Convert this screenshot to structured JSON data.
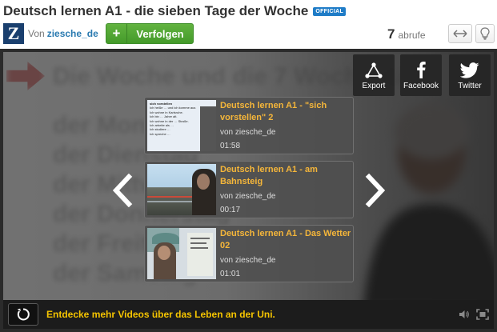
{
  "header": {
    "title": "Deutsch lernen A1 - die sieben Tage der Woche",
    "badge": "OFFICIAL",
    "logo_letter": "Z",
    "from_label": "Von",
    "username": "ziesche_de",
    "follow_label": "Verfolgen",
    "view_count": "7",
    "view_label": "abrufe"
  },
  "share": {
    "export": "Export",
    "facebook": "Facebook",
    "twitter": "Twitter"
  },
  "background_slide": {
    "heading": "Die Woche und die 7 Wochentage",
    "lines": [
      "der Montag",
      "der Dienstag",
      "der Mittwoch",
      "der Donnerstag",
      "der Freitag",
      "der Samstag"
    ]
  },
  "related_videos": [
    {
      "title": "Deutsch lernen A1 -  \"sich vorstellen\" 2",
      "by": "von ziesche_de",
      "duration": "01:58",
      "thumb_lines": [
        "sich vorstellen",
        "Ich heiße … und ich komme aus",
        "Ich wohne in Karlsruhe.",
        "Ich bin … Jahre alt.",
        "Ich wohne in der … Straße.",
        "Ich arbeite als …",
        "Ich studiere …",
        "Ich spreche …"
      ]
    },
    {
      "title": "Deutsch lernen A1 -  am Bahnsteig",
      "by": "von ziesche_de",
      "duration": "00:17"
    },
    {
      "title": "Deutsch lernen A1 - Das Wetter 02",
      "by": "von ziesche_de",
      "duration": "01:01"
    }
  ],
  "bottom_bar": {
    "discover_text": "Entdecke mehr Videos über das Leben an der Uni."
  },
  "colors": {
    "accent_orange": "#f5b63a",
    "discover_yellow": "#f5c400",
    "follow_green": "#52a636",
    "badge_blue": "#1f7cc7",
    "username_blue": "#2a7ab0"
  },
  "icons": {
    "follow": "plus-icon",
    "expand": "horizontal-arrows-icon",
    "lightbulb": "lightbulb-icon",
    "export": "export-icon",
    "facebook": "facebook-icon",
    "twitter": "twitter-icon",
    "prev": "chevron-left-icon",
    "next": "chevron-right-icon",
    "replay": "replay-icon",
    "volume": "volume-icon",
    "fullscreen": "fullscreen-icon"
  }
}
